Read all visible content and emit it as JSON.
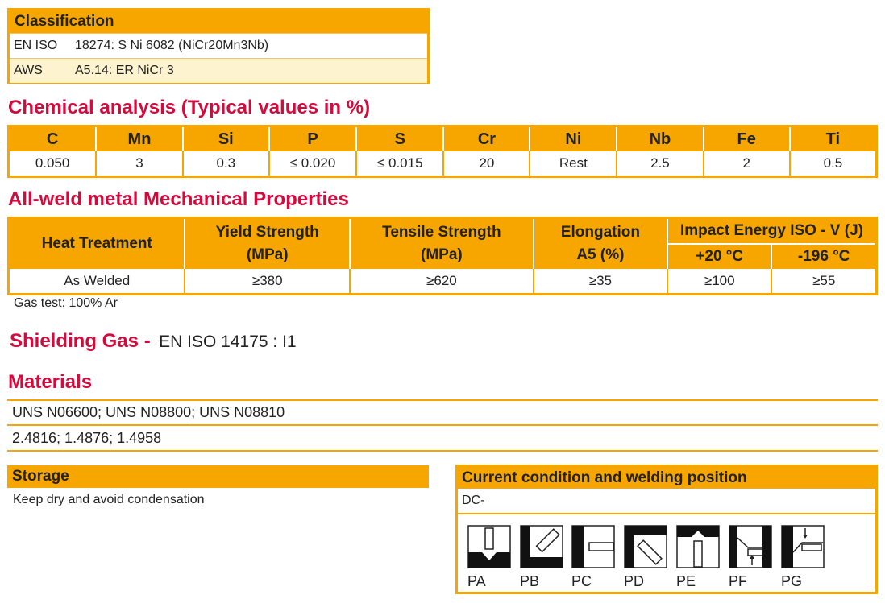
{
  "classification": {
    "title": "Classification",
    "rows": [
      {
        "key": "EN ISO",
        "value": "18274: S Ni 6082 (NiCr20Mn3Nb)"
      },
      {
        "key": "AWS",
        "value": "A5.14: ER NiCr 3"
      }
    ]
  },
  "chemical": {
    "title": "Chemical analysis (Typical values in %)",
    "headers": [
      "C",
      "Mn",
      "Si",
      "P",
      "S",
      "Cr",
      "Ni",
      "Nb",
      "Fe",
      "Ti"
    ],
    "values": [
      "0.050",
      "3",
      "0.3",
      "≤ 0.020",
      "≤ 0.015",
      "20",
      "Rest",
      "2.5",
      "2",
      "0.5"
    ]
  },
  "mechanical": {
    "title": "All-weld metal Mechanical Properties",
    "headers": {
      "heat_treatment": "Heat Treatment",
      "yield_1": "Yield Strength",
      "yield_2": "(MPa)",
      "tensile_1": "Tensile Strength",
      "tensile_2": "(MPa)",
      "elong_1": "Elongation",
      "elong_2": "A5 (%)",
      "impact": "Impact Energy ISO - V (J)",
      "impact_t1": "+20 °C",
      "impact_t2": "-196 °C"
    },
    "row": {
      "heat_treatment": "As Welded",
      "yield": "≥380",
      "tensile": "≥620",
      "elongation": "≥35",
      "impact_t1": "≥100",
      "impact_t2": "≥55"
    },
    "note": "Gas test: 100% Ar"
  },
  "shielding": {
    "title": "Shielding Gas -",
    "value": "EN ISO 14175 : I1"
  },
  "materials": {
    "title": "Materials",
    "lines": [
      "UNS N06600; UNS N08800; UNS N08810",
      "2.4816; 1.4876; 1.4958"
    ]
  },
  "storage": {
    "title": "Storage",
    "text": "Keep dry and avoid condensation"
  },
  "current": {
    "title": "Current condition and welding position",
    "value": "DC-",
    "positions": [
      "PA",
      "PB",
      "PC",
      "PD",
      "PE",
      "PF",
      "PG"
    ]
  },
  "colors": {
    "accent": "#f7a600",
    "heading": "#d40a3c"
  }
}
